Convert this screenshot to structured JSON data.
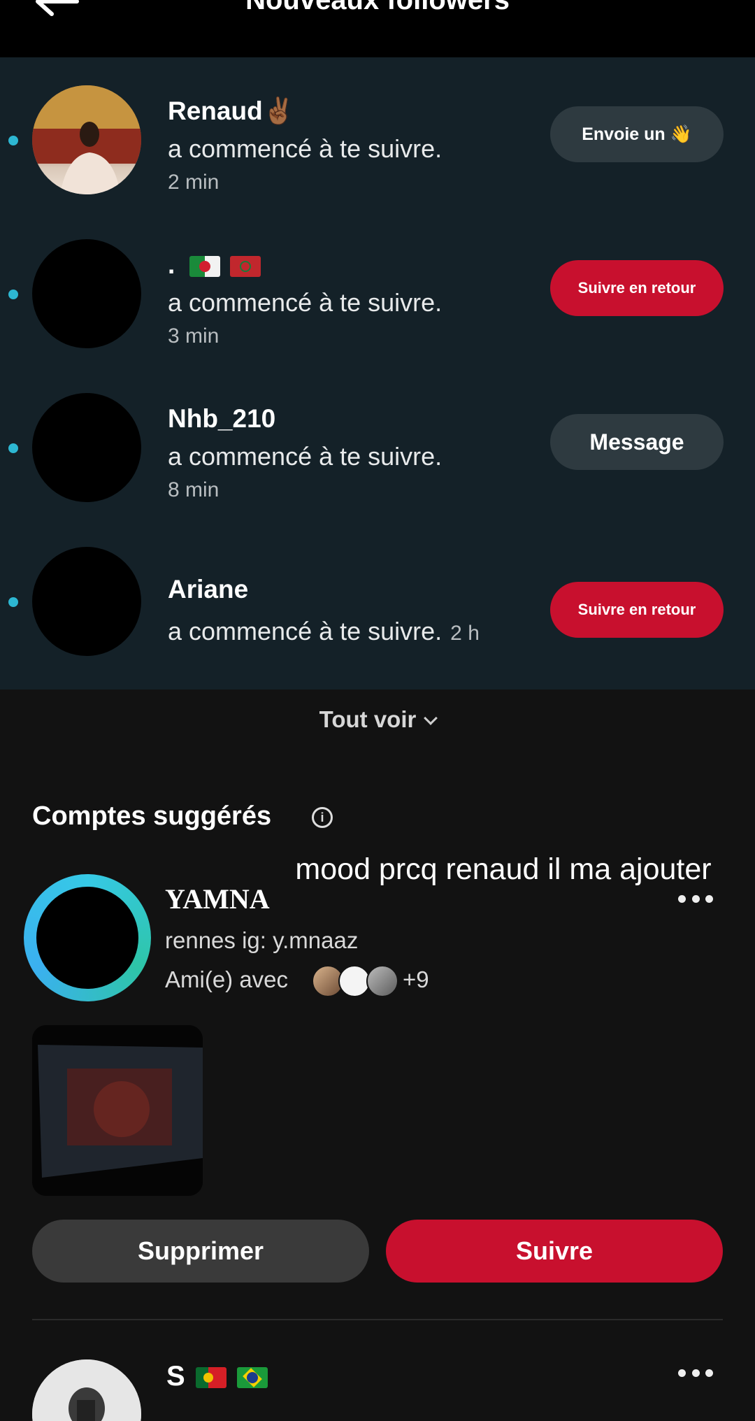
{
  "header": {
    "title": "Nouveaux followers",
    "back_icon": "arrow-left-icon"
  },
  "followers": [
    {
      "username": "Renaud✌🏾",
      "action": "a commencé à te suivre.",
      "time": "2 min",
      "button": "Envoie un 👋",
      "button_style": "grey"
    },
    {
      "username": ".",
      "action": "a commencé à te suivre.",
      "time": "3 min",
      "button": "Suivre en retour",
      "button_style": "red"
    },
    {
      "username": "Nhb_210",
      "action": "a commencé à te suivre.",
      "time": "8 min",
      "button": "Message",
      "button_style": "grey"
    },
    {
      "username": "Ariane",
      "action": "a commencé à te suivre.",
      "time": "2 h",
      "button": "Suivre en retour",
      "button_style": "red"
    }
  ],
  "see_all": "Tout voir",
  "suggested": {
    "title": "Comptes suggérés",
    "overlay_caption": "mood prcq renaud il ma ajouter",
    "account1": {
      "name": "YAMNA",
      "bio": "rennes ig: y.mnaaz",
      "friends_prefix": "Ami(e) avec",
      "friends_more": "+9"
    },
    "dismiss_label": "Supprimer",
    "follow_label": "Suivre",
    "account2": {
      "name": "S",
      "bio_emoji": "🙋🏽🙋🏽"
    }
  },
  "colors": {
    "accent_red": "#c8102e",
    "accent_blue": "#2db7d2",
    "panel_bg": "#142128",
    "page_bg": "#121212"
  }
}
